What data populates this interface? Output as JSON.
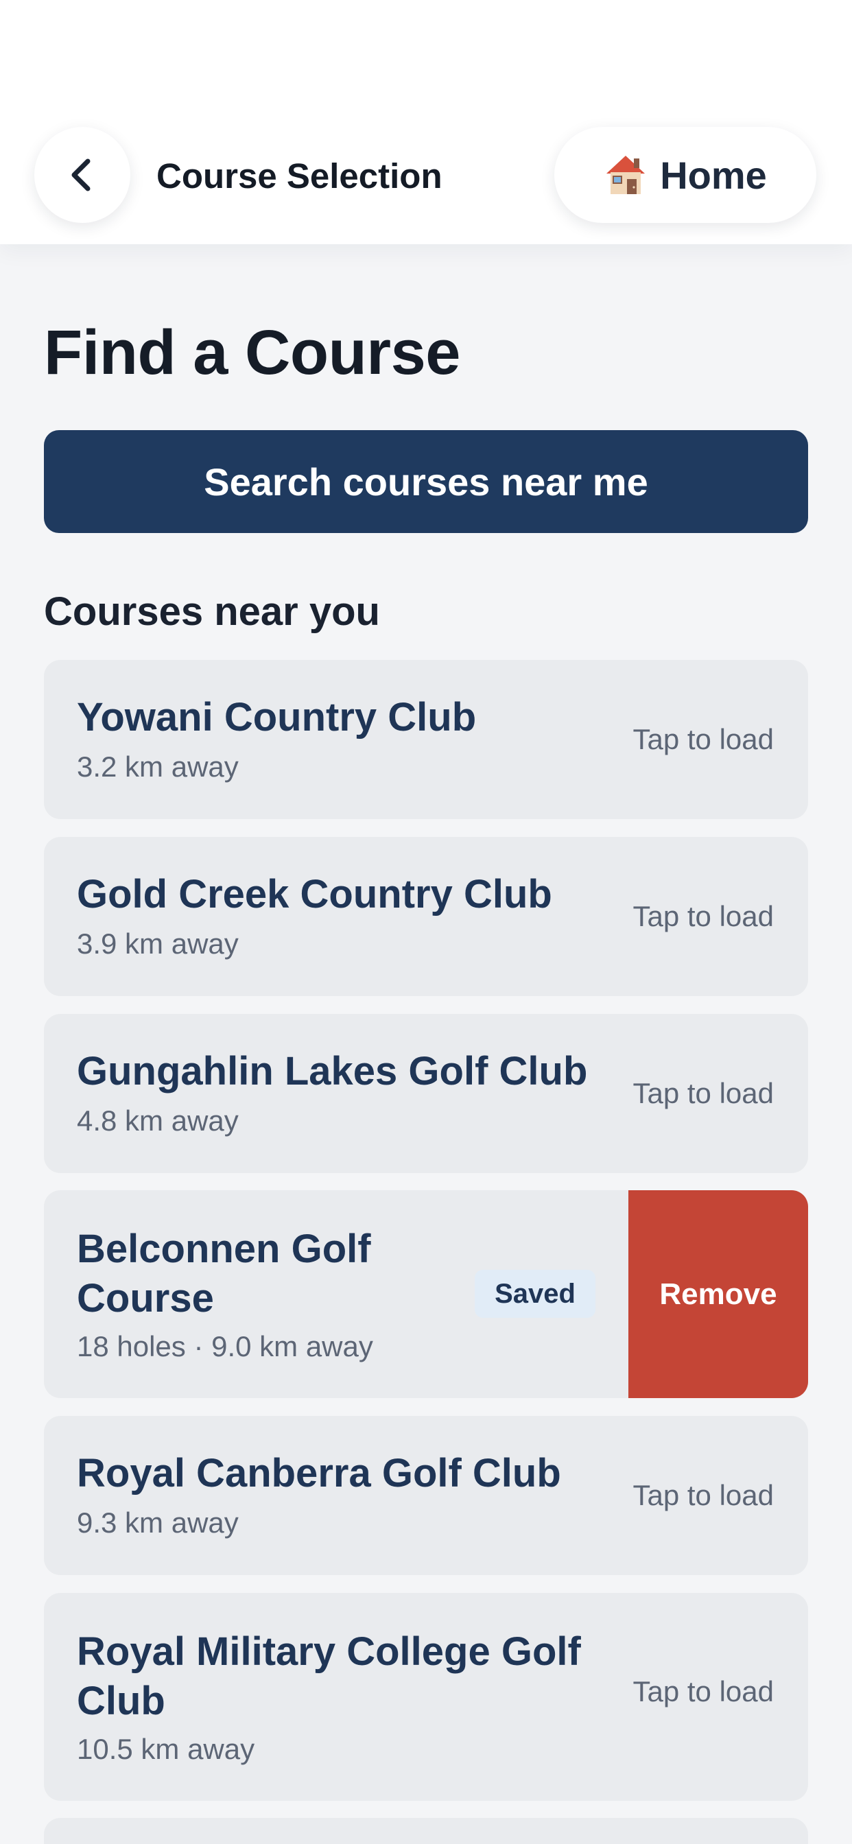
{
  "header": {
    "title": "Course Selection",
    "home_label": "Home",
    "home_icon": "house-emoji",
    "back_icon": "chevron-left-icon"
  },
  "main": {
    "title": "Find a Course",
    "search_button_label": "Search courses near me",
    "section_title": "Courses near you"
  },
  "courses": [
    {
      "name": "Yowani Country Club",
      "distance": "3.2 km away",
      "action": "Tap to load"
    },
    {
      "name": "Gold Creek Country Club",
      "distance": "3.9 km away",
      "action": "Tap to load"
    },
    {
      "name": "Gungahlin Lakes Golf Club",
      "distance": "4.8 km away",
      "action": "Tap to load"
    },
    {
      "name_line1": "Belconnen Golf",
      "name_line2": "Course",
      "distance": "18 holes · 9.0 km away",
      "badge": "Saved",
      "swipe_action": "Remove"
    },
    {
      "name": "Royal Canberra Golf Club",
      "distance": "9.3 km away",
      "action": "Tap to load"
    },
    {
      "name_line1": "Royal Military College Golf",
      "name_line2": "Club",
      "distance": "10.5 km away",
      "action": "Tap to load"
    }
  ],
  "colors": {
    "primary": "#1f3a5f",
    "danger": "#c44536",
    "background": "#f4f5f7",
    "card": "#e9ebee"
  }
}
